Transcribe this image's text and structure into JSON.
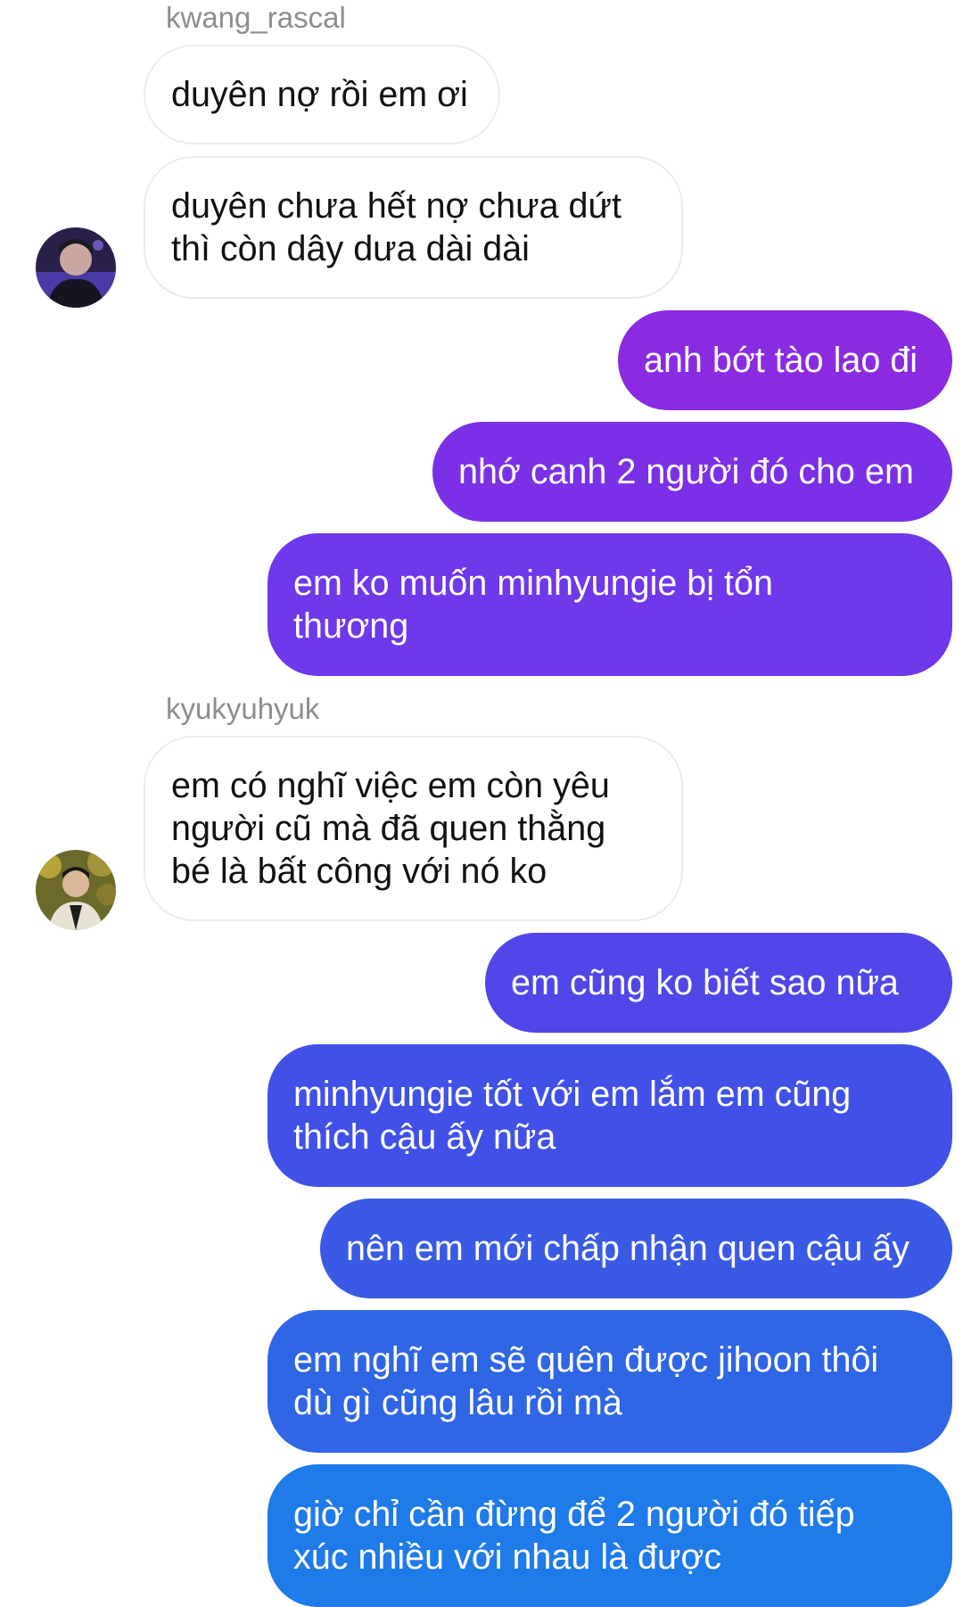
{
  "conversation": {
    "senders": [
      {
        "username": "kwang_rascal",
        "avatar_icon": "profile-photo-icon"
      },
      {
        "username": "kyukyuhyuk",
        "avatar_icon": "profile-photo-icon"
      }
    ],
    "messages": [
      {
        "direction": "incoming",
        "text": "duyên nợ rồi em ơi"
      },
      {
        "direction": "incoming",
        "lines": [
          "duyên chưa hết nợ chưa dứt",
          "thì còn dây dưa dài dài"
        ]
      },
      {
        "direction": "outgoing",
        "text": "anh bớt tào lao đi"
      },
      {
        "direction": "outgoing",
        "text": "nhớ canh 2 người đó cho em"
      },
      {
        "direction": "outgoing",
        "lines": [
          "em ko muốn minhyungie bị tổn",
          "thương"
        ]
      },
      {
        "direction": "incoming",
        "lines": [
          "em có nghĩ việc em còn yêu",
          "người cũ mà đã quen thằng",
          "bé là bất công với nó ko"
        ]
      },
      {
        "direction": "outgoing",
        "text": "em cũng ko biết sao nữa"
      },
      {
        "direction": "outgoing",
        "lines": [
          "minhyungie tốt với em lắm em cũng",
          "thích cậu ấy nữa"
        ]
      },
      {
        "direction": "outgoing",
        "text": "nên em mới chấp nhận quen cậu ấy"
      },
      {
        "direction": "outgoing",
        "lines": [
          "em nghĩ em sẽ quên được jihoon thôi",
          "dù gì cũng lâu rồi mà"
        ]
      },
      {
        "direction": "outgoing",
        "lines": [
          "giờ chỉ cần đừng để 2 người đó tiếp",
          "xúc nhiều với nhau là được"
        ]
      }
    ]
  },
  "colors": {
    "incoming_bubble_bg": "#ffffff",
    "incoming_bubble_border": "#ececec",
    "incoming_text": "#111111",
    "outgoing_text": "#ffffff",
    "sender_name": "#8e8e8e",
    "outgoing_gradient": [
      "#8a2be2",
      "#7137ea",
      "#4a55e8",
      "#3b5ce6",
      "#2e6ee6",
      "#1f7eea"
    ]
  }
}
